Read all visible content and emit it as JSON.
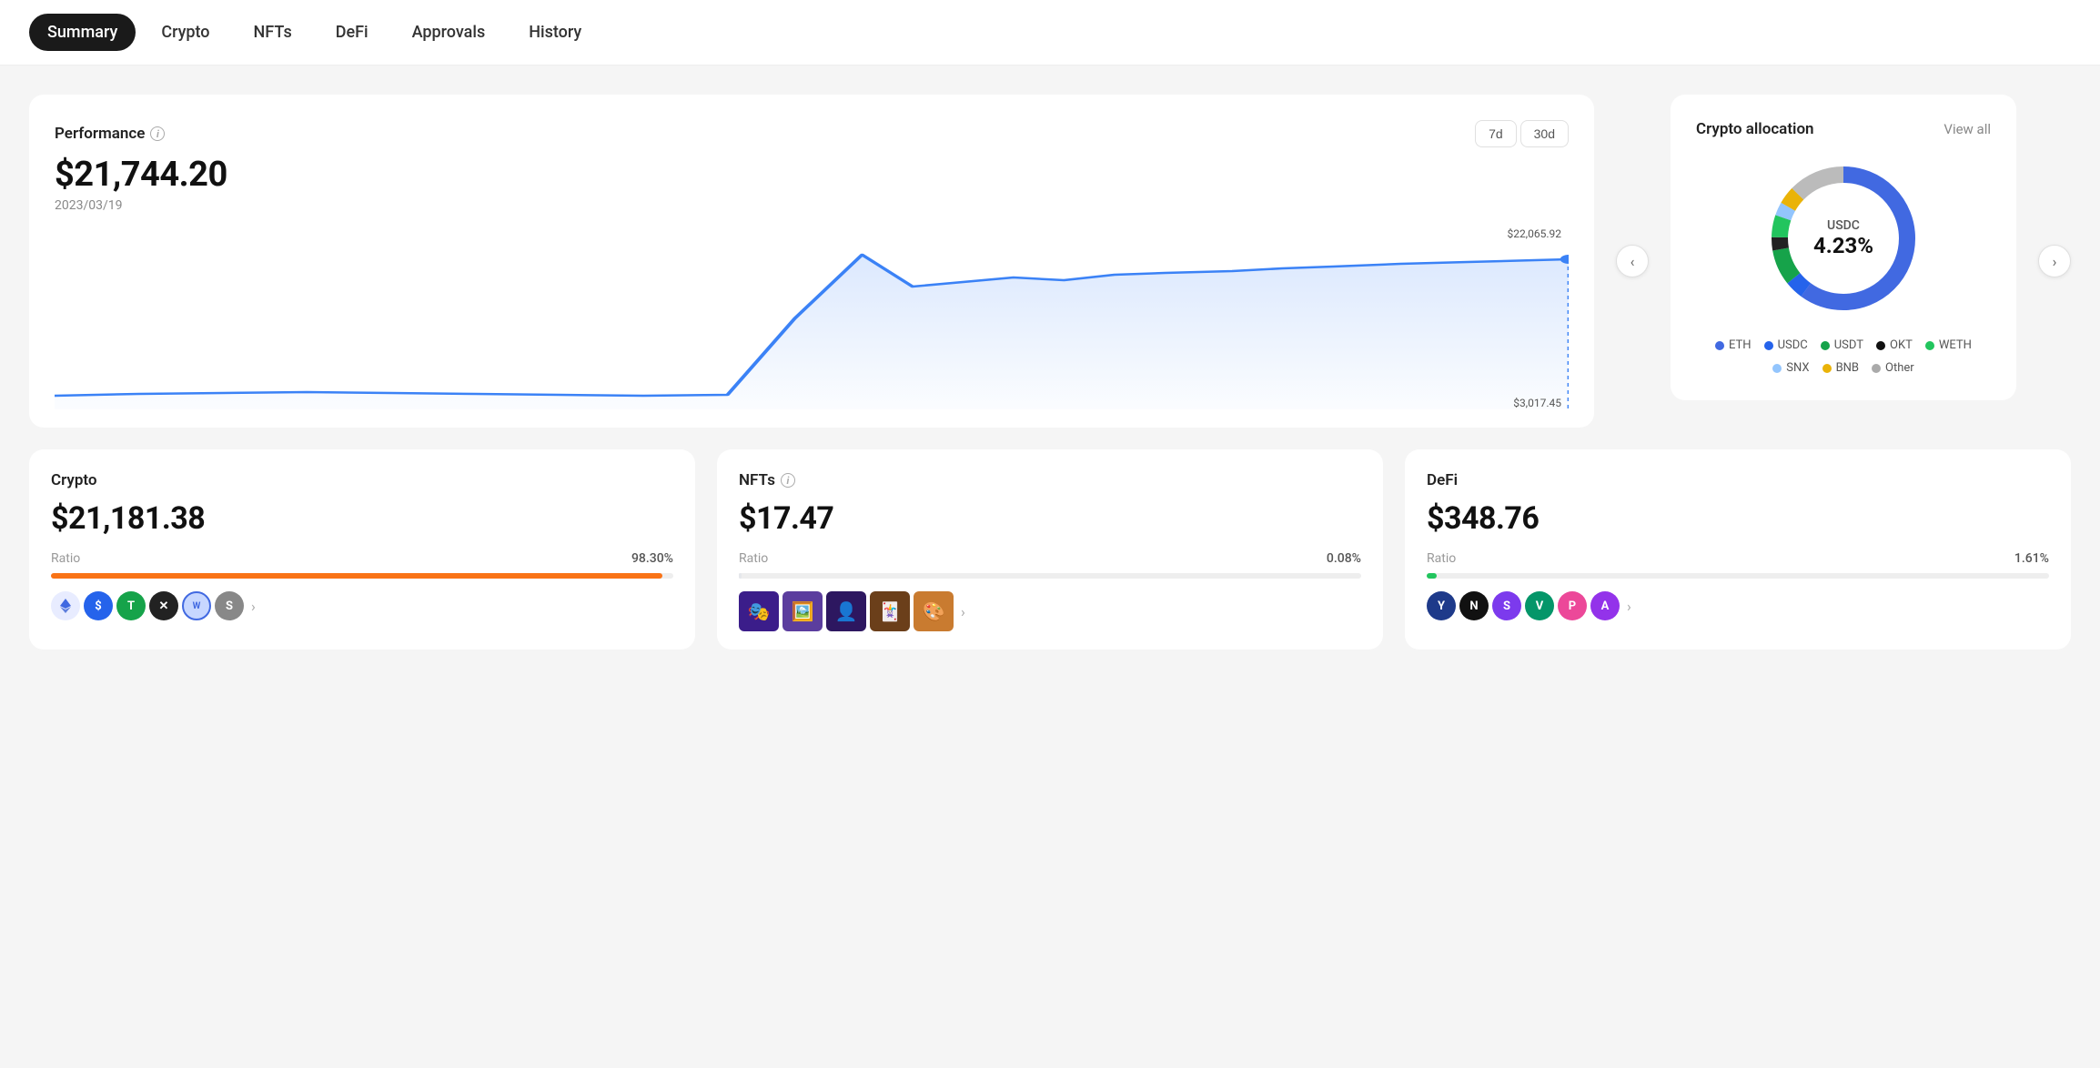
{
  "nav": {
    "items": [
      {
        "id": "summary",
        "label": "Summary",
        "active": true
      },
      {
        "id": "crypto",
        "label": "Crypto",
        "active": false
      },
      {
        "id": "nfts",
        "label": "NFTs",
        "active": false
      },
      {
        "id": "defi",
        "label": "DeFi",
        "active": false
      },
      {
        "id": "approvals",
        "label": "Approvals",
        "active": false
      },
      {
        "id": "history",
        "label": "History",
        "active": false
      }
    ]
  },
  "performance": {
    "title": "Performance",
    "amount": "$21,744.20",
    "date": "2023/03/19",
    "high_label": "$22,065.92",
    "low_label": "$3,017.45",
    "time_buttons": [
      "7d",
      "30d"
    ]
  },
  "allocation": {
    "title": "Crypto allocation",
    "view_all": "View all",
    "center_token": "USDC",
    "center_pct": "4.23%",
    "legend": [
      {
        "label": "ETH",
        "color": "#4169e1"
      },
      {
        "label": "USDC",
        "color": "#2563eb"
      },
      {
        "label": "USDT",
        "color": "#16a34a"
      },
      {
        "label": "OKT",
        "color": "#111"
      },
      {
        "label": "WETH",
        "color": "#22c55e"
      },
      {
        "label": "SNX",
        "color": "#93c5fd"
      },
      {
        "label": "BNB",
        "color": "#eab308"
      },
      {
        "label": "Other",
        "color": "#aaa"
      }
    ],
    "segments": [
      {
        "pct": 60,
        "color": "#4169e1"
      },
      {
        "pct": 4.23,
        "color": "#2563eb"
      },
      {
        "pct": 8,
        "color": "#16a34a"
      },
      {
        "pct": 3,
        "color": "#111"
      },
      {
        "pct": 5,
        "color": "#22c55e"
      },
      {
        "pct": 3,
        "color": "#93c5fd"
      },
      {
        "pct": 4,
        "color": "#eab308"
      },
      {
        "pct": 12.77,
        "color": "#aaa"
      }
    ]
  },
  "crypto_card": {
    "title": "Crypto",
    "amount": "$21,181.38",
    "ratio_label": "Ratio",
    "ratio_value": "98.30%",
    "ratio_pct": 98.3,
    "bar_color": "#f97316",
    "tokens": [
      {
        "symbol": "ETH",
        "color": "#4169e1",
        "bg": "#e8ecff",
        "emoji": "◈"
      },
      {
        "symbol": "USD",
        "color": "#2563eb",
        "bg": "#dbeafe",
        "emoji": "$"
      },
      {
        "symbol": "T",
        "color": "#16a34a",
        "bg": "#dcfce7",
        "emoji": "T"
      },
      {
        "symbol": "X",
        "color": "#555",
        "bg": "#f0f0f0",
        "emoji": "✕"
      },
      {
        "symbol": "W",
        "color": "#4169e1",
        "bg": "#e8ecff",
        "emoji": "W"
      },
      {
        "symbol": "S",
        "color": "#ccc",
        "bg": "#f5f5f5",
        "emoji": "S"
      }
    ]
  },
  "nfts_card": {
    "title": "NFTs",
    "amount": "$17.47",
    "ratio_label": "Ratio",
    "ratio_value": "0.08%",
    "ratio_pct": 0.08,
    "bar_color": "#e5e7eb",
    "thumbs": [
      "🎭",
      "🖼️",
      "👤",
      "🃏",
      "🎨"
    ]
  },
  "defi_card": {
    "title": "DeFi",
    "amount": "$348.76",
    "ratio_label": "Ratio",
    "ratio_value": "1.61%",
    "ratio_pct": 1.61,
    "bar_color": "#22c55e",
    "tokens": [
      {
        "symbol": "Y",
        "color": "#1e40af",
        "bg": "#1e40af"
      },
      {
        "symbol": "N",
        "color": "#111",
        "bg": "#111"
      },
      {
        "symbol": "S",
        "color": "#7c3aed",
        "bg": "#7c3aed"
      },
      {
        "symbol": "V",
        "color": "#059669",
        "bg": "#059669"
      },
      {
        "symbol": "P",
        "color": "#ec4899",
        "bg": "#ec4899"
      },
      {
        "symbol": "A",
        "color": "#7c3aed",
        "bg": "#9333ea"
      }
    ]
  }
}
